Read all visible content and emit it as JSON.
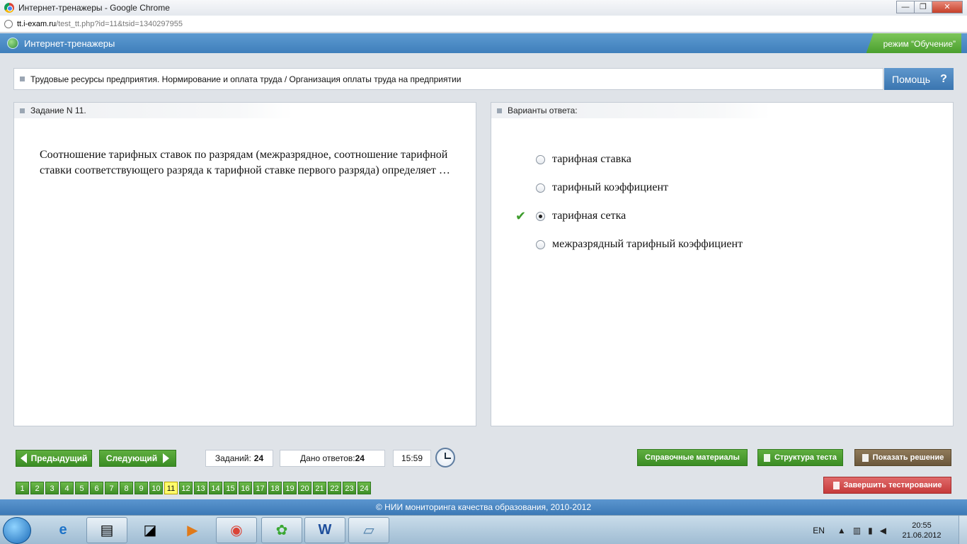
{
  "window": {
    "title": "Интернет-тренажеры - Google Chrome",
    "controls": {
      "minimize": "—",
      "maximize": "❐",
      "close": "✕"
    }
  },
  "address": {
    "host": "tt.i-exam.ru",
    "path": "/test_tt.php?id=11&tsid=1340297955"
  },
  "header": {
    "brand": "Интернет-тренажеры",
    "mode": "режим “Обучение”"
  },
  "topic": {
    "text": "Трудовые ресурсы предприятия. Нормирование и оплата труда / Организация оплаты труда на предприятии",
    "help_label": "Помощь",
    "help_glyph": "?"
  },
  "question": {
    "heading": "Задание N 11.",
    "text": "Соотношение тарифных ставок по разрядам (межразрядное, соотношение тарифной ставки соответствующего разряда к тарифной ставке первого разряда) определяет …"
  },
  "answers": {
    "heading": "Варианты ответа:",
    "items": [
      {
        "label": "тарифная ставка",
        "selected": false,
        "correct_mark": ""
      },
      {
        "label": "тарифный коэффициент",
        "selected": false,
        "correct_mark": ""
      },
      {
        "label": "тарифная сетка",
        "selected": true,
        "correct_mark": "✔"
      },
      {
        "label": "межразрядный тарифный коэффициент",
        "selected": false,
        "correct_mark": ""
      }
    ]
  },
  "nav": {
    "prev_label": "Предыдущий",
    "next_label": "Следующий",
    "tasks_label": "Заданий:",
    "tasks_value": "24",
    "answered_label": "Дано ответов:",
    "answered_value": "24",
    "timer": "15:59",
    "reference_label": "Справочные материалы",
    "structure_label": "Структура теста",
    "solution_label": "Показать решение",
    "finish_label": "Завершить тестирование",
    "pages": [
      "1",
      "2",
      "3",
      "4",
      "5",
      "6",
      "7",
      "8",
      "9",
      "10",
      "11",
      "12",
      "13",
      "14",
      "15",
      "16",
      "17",
      "18",
      "19",
      "20",
      "21",
      "22",
      "23",
      "24"
    ],
    "current_page": "11"
  },
  "footer": {
    "text": "© НИИ мониторинга качества образования, 2010-2012"
  },
  "taskbar": {
    "lang": "EN",
    "time": "20:55",
    "date": "21.06.2012"
  },
  "colors": {
    "header_blue": "#4a88c4",
    "accent_green": "#4a9f2e",
    "current_page_yellow": "#fffb6a",
    "finish_red": "#c63a3a"
  }
}
